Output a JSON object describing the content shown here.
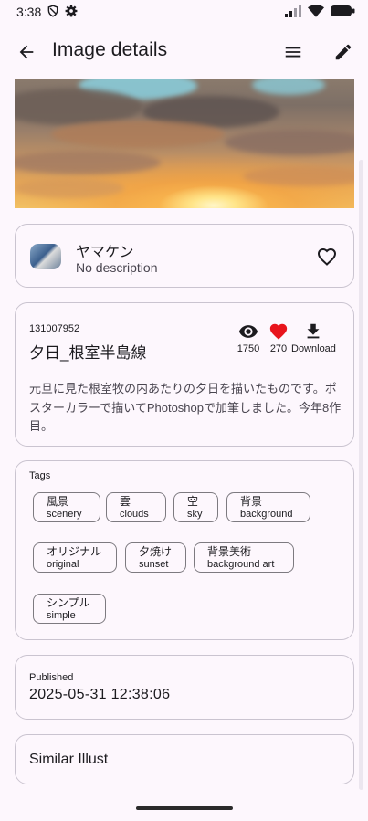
{
  "status_bar": {
    "time": "3:38"
  },
  "app_bar": {
    "title": "Image details"
  },
  "author": {
    "name": "ヤマケン",
    "description": "No description"
  },
  "illust": {
    "id": "131007952",
    "title": "夕日_根室半島線",
    "views": "1750",
    "likes": "270",
    "download_label": "Download",
    "caption": "元旦に見た根室牧の内あたりの夕日を描いたものです。ポスターカラーで描いてPhotoshopで加筆しました。今年8作目。"
  },
  "tags": {
    "label": "Tags",
    "items": [
      {
        "jp": "風景",
        "en": "scenery"
      },
      {
        "jp": "雲",
        "en": "clouds"
      },
      {
        "jp": "空",
        "en": "sky"
      },
      {
        "jp": "背景",
        "en": "background"
      },
      {
        "jp": "オリジナル",
        "en": "original"
      },
      {
        "jp": "夕焼け",
        "en": "sunset"
      },
      {
        "jp": "背景美術",
        "en": "background art"
      },
      {
        "jp": "シンプル",
        "en": "simple"
      }
    ]
  },
  "published": {
    "label": "Published",
    "date": "2025-05-31 12:38:06"
  },
  "similar": {
    "label": "Similar Illust"
  },
  "colors": {
    "background": "#fdf7fd",
    "border": "#cac4d0",
    "heart": "#e8141c"
  }
}
